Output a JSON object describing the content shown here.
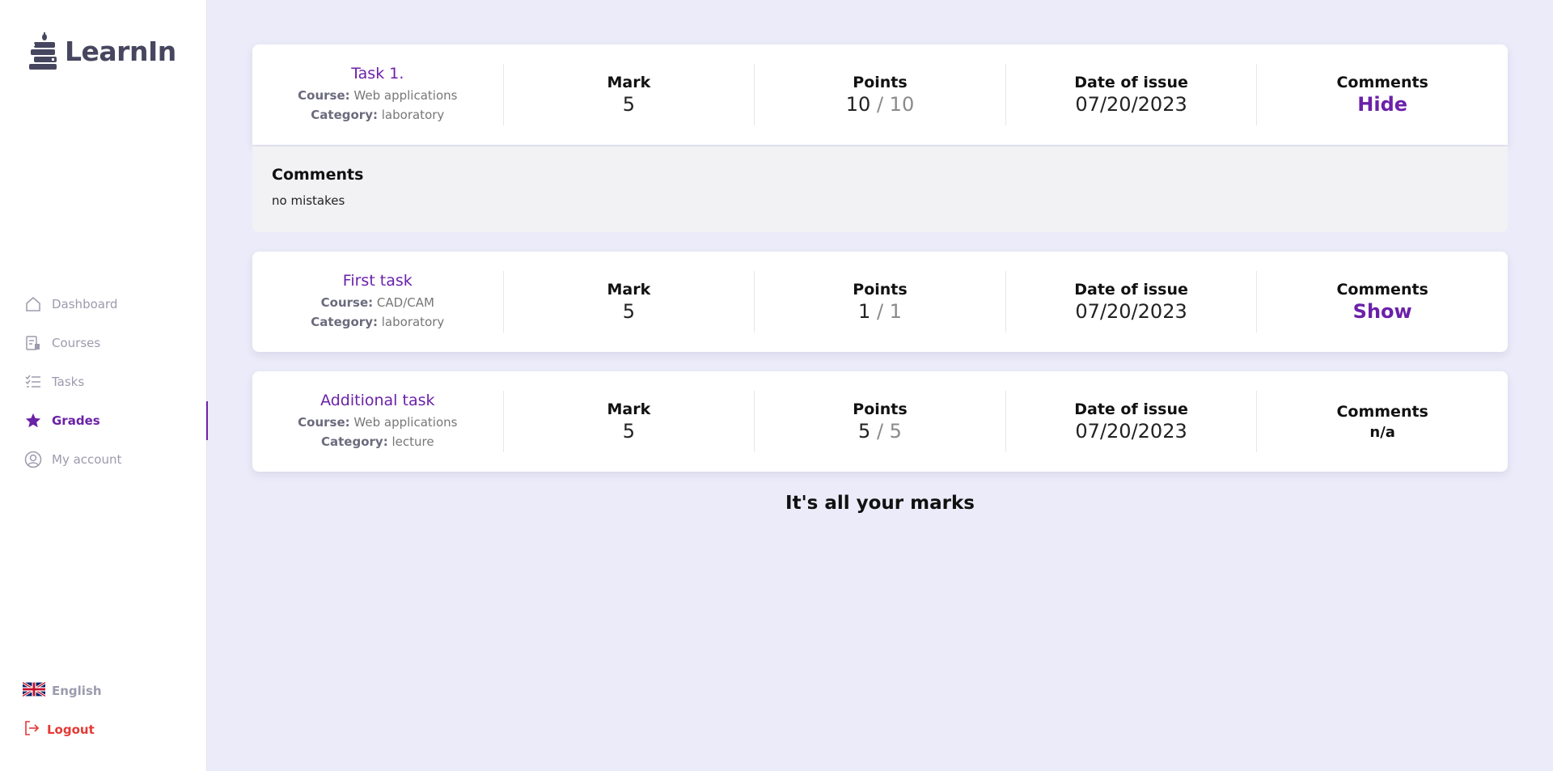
{
  "app": {
    "name": "LearnIn"
  },
  "sidebar": {
    "items": [
      {
        "label": "Dashboard",
        "icon": "home-icon"
      },
      {
        "label": "Courses",
        "icon": "courses-icon"
      },
      {
        "label": "Tasks",
        "icon": "tasks-icon"
      },
      {
        "label": "Grades",
        "icon": "star-icon",
        "active": true
      },
      {
        "label": "My account",
        "icon": "user-icon"
      }
    ],
    "language": "English",
    "logout": "Logout"
  },
  "labels": {
    "course": "Course:",
    "category": "Category:",
    "mark": "Mark",
    "points": "Points",
    "date": "Date of issue",
    "comments": "Comments",
    "separator": "/"
  },
  "grades": [
    {
      "title": "Task 1.",
      "course": "Web applications",
      "category": "laboratory",
      "mark": "5",
      "points": "10",
      "max_points": "10",
      "date": "07/20/2023",
      "comments_toggle": "Hide",
      "comments_panel": {
        "heading": "Comments",
        "text": "no mistakes"
      }
    },
    {
      "title": "First task",
      "course": "CAD/CAM",
      "category": "laboratory",
      "mark": "5",
      "points": "1",
      "max_points": "1",
      "date": "07/20/2023",
      "comments_toggle": "Show"
    },
    {
      "title": "Additional task",
      "course": "Web applications",
      "category": "lecture",
      "mark": "5",
      "points": "5",
      "max_points": "5",
      "date": "07/20/2023",
      "comments_value": "n/a"
    }
  ],
  "footer_message": "It's all your marks",
  "colors": {
    "accent": "#6b21a8",
    "logout": "#e53935",
    "background": "#ebebf9"
  }
}
